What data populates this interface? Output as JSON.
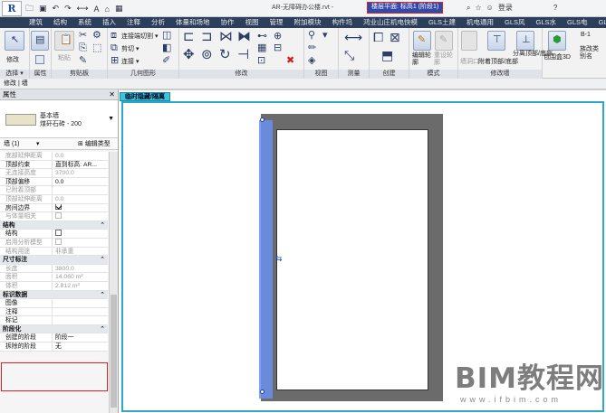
{
  "app": {
    "logo": "R",
    "title_center": "AR-无障碍办公楼.rvt -",
    "title_selected": "楼层平面: 标高1 (阶段1)",
    "search_icon": "binoculars-icon",
    "login": "登录",
    "help": "?"
  },
  "qat": {
    "items": [
      "open-icon",
      "save-icon",
      "undo-icon",
      "redo-icon",
      "measure-icon",
      "text-icon",
      "A",
      "3d-icon",
      "window-icon"
    ]
  },
  "tabs": [
    "建筑",
    "结构",
    "系统",
    "插入",
    "注释",
    "分析",
    "体量和场地",
    "协作",
    "视图",
    "管理",
    "附加模块",
    "构件坞",
    "鸿业山庄机电快模",
    "GLS土建",
    "机电通用",
    "GLS风",
    "GLS水",
    "GLS电",
    "GLS出图",
    "修改 | 墙"
  ],
  "ribbon": {
    "panels": {
      "select": "选择 ▾",
      "properties": "属性",
      "clipboard": "剪贴板",
      "geometry": "几何图形",
      "modify": "修改",
      "view": "视图",
      "measure": "测量",
      "create": "创建",
      "mode": "模式",
      "modify_wall": "修改墙"
    },
    "buttons": {
      "modify": "修改",
      "paste": "粘贴",
      "cut_connect": "连接端切割 ▾",
      "cut": "剪切 ▾",
      "join": "连接 ▾",
      "edit_profile": "编辑轮廓",
      "reset_profile": "重设轮廓",
      "wall_opening": "墙洞口",
      "attach": "附着顶部/底部",
      "detach": "分离顶部/底部",
      "envelope3d": "包围盒3D",
      "change_type": "族改类别名"
    }
  },
  "optbar": {
    "text": "修改 | 墙"
  },
  "props": {
    "title": "属性",
    "type_name": "基本墙",
    "type_sub": "煤矸石砖 - 200",
    "instance": "墙 (1)",
    "edit_type": "编辑类型",
    "rows": [
      {
        "k": "底部延伸距离",
        "v": "0.0",
        "g": true
      },
      {
        "k": "顶部约束",
        "v": "直到标高: AR..."
      },
      {
        "k": "无连接高度",
        "v": "3700.0",
        "g": true
      },
      {
        "k": "顶部偏移",
        "v": "0.0"
      },
      {
        "k": "已附着顶部",
        "v": "",
        "g": true
      },
      {
        "k": "顶部延伸距离",
        "v": "0.0",
        "g": true
      },
      {
        "k": "房间边界",
        "v": "",
        "cb": true
      },
      {
        "k": "与体量相关",
        "v": "",
        "g": true,
        "cbg": true
      },
      {
        "sec": "结构"
      },
      {
        "k": "结构",
        "v": "",
        "cbe": true
      },
      {
        "k": "启用分析模型",
        "v": "",
        "g": true,
        "cbg": true
      },
      {
        "k": "结构用途",
        "v": "非承重",
        "g": true
      },
      {
        "sec": "尺寸标注"
      },
      {
        "k": "长度",
        "v": "3800.0",
        "g": true
      },
      {
        "k": "面积",
        "v": "14.060 m²",
        "g": true
      },
      {
        "k": "体积",
        "v": "2.812 m³",
        "g": true
      },
      {
        "sec": "标识数据"
      },
      {
        "k": "图像",
        "v": ""
      },
      {
        "k": "注释",
        "v": ""
      },
      {
        "k": "标记",
        "v": ""
      },
      {
        "sec": "阶段化"
      },
      {
        "k": "创建的阶段",
        "v": "阶段一"
      },
      {
        "k": "拆除的阶段",
        "v": "无"
      }
    ]
  },
  "view": {
    "tab_label": "临时隐藏/隔离"
  },
  "watermark": {
    "text": "BIM教程网",
    "url": "www.ifbim.com"
  }
}
